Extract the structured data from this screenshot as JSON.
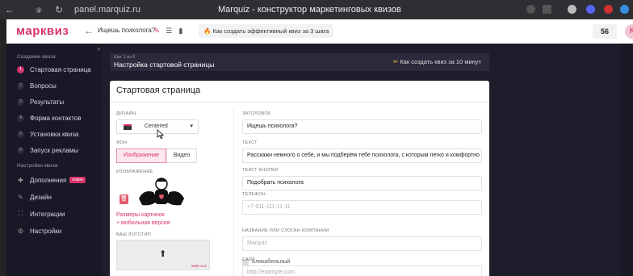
{
  "browser": {
    "url": "panel.marquiz.ru",
    "title": "Marquiz - конструктор маркетинговых квизов"
  },
  "header": {
    "logo": "марквиз",
    "quiz_name": "Ищешь психолога?",
    "tip": "Как создать эффективный квиз за 3 шага",
    "counter": "56",
    "avatar": "K"
  },
  "sidebar": {
    "section_create": "Создание квиза",
    "steps": [
      {
        "num": "1",
        "label": "Стартовая страница"
      },
      {
        "num": "2",
        "label": "Вопросы"
      },
      {
        "num": "3",
        "label": "Результаты"
      },
      {
        "num": "4",
        "label": "Форма контактов"
      },
      {
        "num": "5",
        "label": "Установка квиза"
      },
      {
        "num": "6",
        "label": "Запуск рекламы"
      }
    ],
    "section_settings": "Настройки квиза",
    "settings": [
      {
        "label": "Дополнения",
        "badge": "новое",
        "icon": "puzzle-icon"
      },
      {
        "label": "Дизайн",
        "icon": "pen-icon"
      },
      {
        "label": "Интеграции",
        "icon": "plug-icon"
      },
      {
        "label": "Настройки",
        "icon": "gear-icon"
      }
    ]
  },
  "stepbar": {
    "step": "Шаг 1 из 6",
    "title": "Настройка стартовой страницы",
    "video_link": "Как создать квиз за 10 минут"
  },
  "panel": {
    "title": "Стартовая страница",
    "design_label": "ДИЗАЙН",
    "design_value": "Centered",
    "bg_label": "ФОН",
    "bg_options": [
      "Изображение",
      "Видео"
    ],
    "image_label": "ИЗОБРАЖЕНИЕ",
    "image_size_link": "Размеры картинок",
    "mobile_link": "+ мобильная версия",
    "logo_label": "ВАШ ЛОГОТИП",
    "logo_size": "5MB max",
    "heading_label": "ЗАГОЛОВОК",
    "heading_value": "Ищешь психолога?",
    "text_label": "ТЕКСТ",
    "text_value": "Расскажи немного о себе, и мы подберём тебе психолога, с которым легко и комфортно",
    "button_label": "ТЕКСТ КНОПКИ",
    "button_value": "Подобрать психолога",
    "phone_label": "ТЕЛЕФОН",
    "phone_placeholder": "+7-911-111-11-11",
    "clickable_label": "Кликабельный",
    "company_label": "НАЗВАНИЕ ИЛИ СЛОГАН КОМПАНИИ",
    "company_placeholder": "Marquiz",
    "site_label": "САЙТ",
    "site_placeholder": "http://example.com"
  }
}
